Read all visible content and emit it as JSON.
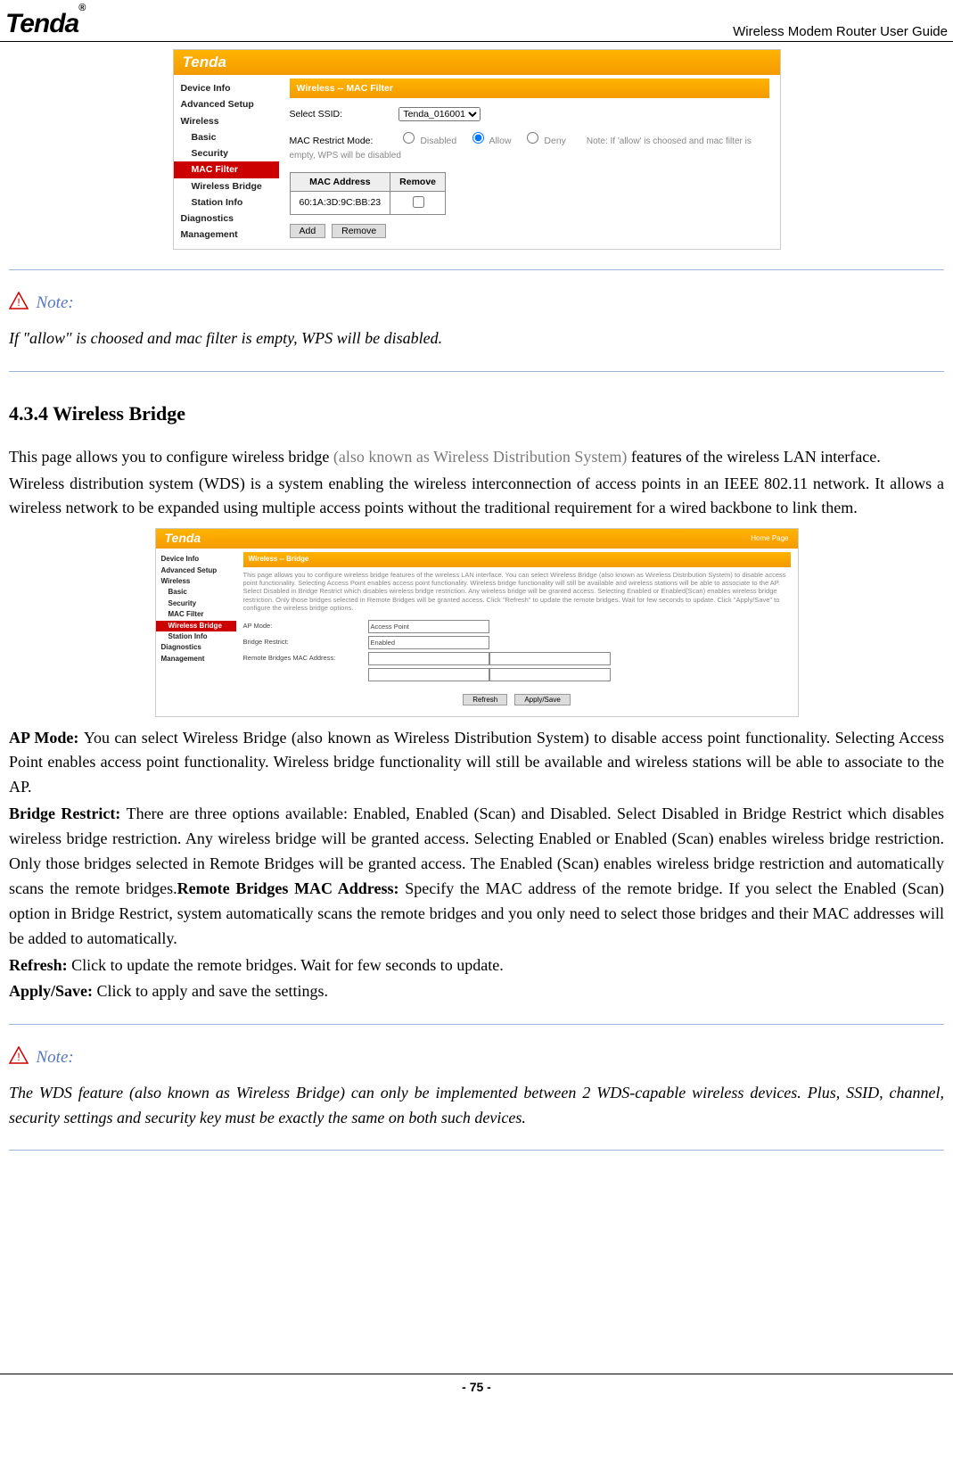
{
  "header": {
    "logo_text": "Tenda",
    "doc_title": "Wireless Modem Router User Guide"
  },
  "screenshot1": {
    "brand": "Tenda",
    "panel_title": "Wireless -- MAC Filter",
    "sidebar": {
      "items": [
        "Device Info",
        "Advanced Setup",
        "Wireless"
      ],
      "subs": [
        "Basic",
        "Security"
      ],
      "active": "MAC Filter",
      "subs2": [
        "Wireless Bridge",
        "Station Info"
      ],
      "items2": [
        "Diagnostics",
        "Management"
      ]
    },
    "ssid_label": "Select SSID:",
    "ssid_value": "Tenda_016001",
    "restrict_label": "MAC Restrict Mode:",
    "opt_disabled": "Disabled",
    "opt_allow": "Allow",
    "opt_deny": "Deny",
    "restrict_note": "Note: If 'allow' is choosed and mac filter is empty, WPS will be disabled",
    "col_mac": "MAC Address",
    "col_remove": "Remove",
    "mac_value": "60:1A:3D:9C:BB:23",
    "btn_add": "Add",
    "btn_remove": "Remove"
  },
  "note1": {
    "label": "Note:",
    "body": "If \"allow\" is choosed and mac filter is empty, WPS will be disabled."
  },
  "section": {
    "heading": "4.3.4 Wireless Bridge",
    "p1a": "This page allows you to configure wireless bridge ",
    "p1b": "(also known as Wireless Distribution System)",
    "p1c": " features of the wireless LAN interface.",
    "p2": "Wireless distribution system (WDS) is a system enabling the wireless interconnection of access points in an IEEE 802.11 network. It allows a wireless network to be expanded using multiple access points without the traditional requirement for a wired backbone to link them."
  },
  "screenshot2": {
    "brand": "Tenda",
    "home": "Home Page",
    "panel_title": "Wireless -- Bridge",
    "sidebar": {
      "items": [
        "Device Info",
        "Advanced Setup",
        "Wireless"
      ],
      "subs": [
        "Basic",
        "Security",
        "MAC Filter"
      ],
      "active": "Wireless Bridge",
      "subs2": [
        "Station Info"
      ],
      "items2": [
        "Diagnostics",
        "Management"
      ]
    },
    "desc": "This page allows you to configure wireless bridge features of the wireless LAN interface. You can select Wireless Bridge (also known as Wireless Distribution System) to disable access point functionality. Selecting Access Point enables access point functionality. Wireless bridge functionality will still be available and wireless stations will be able to associate to the AP. Select Disabled in Bridge Restrict which disables wireless bridge restriction. Any wireless bridge will be granted access. Selecting Enabled or Enabled(Scan) enables wireless bridge restriction. Only those bridges selected in Remote Bridges will be granted access. Click \"Refresh\" to update the remote bridges. Wait for few seconds to update. Click \"Apply/Save\" to configure the wireless bridge options.",
    "f_apmode_lbl": "AP Mode:",
    "f_apmode_val": "Access Point",
    "f_restrict_lbl": "Bridge Restrict:",
    "f_restrict_val": "Enabled",
    "f_remote_lbl": "Remote Bridges MAC Address:",
    "btn_refresh": "Refresh",
    "btn_apply": "Apply/Save"
  },
  "defs": {
    "apmode_label": "AP Mode: ",
    "apmode_body": "You can select Wireless Bridge (also known as Wireless Distribution System) to disable access point functionality. Selecting Access Point enables access point functionality. Wireless bridge functionality will still be available and wireless stations will be able to associate to the AP.",
    "brestrict_label": "Bridge Restrict: ",
    "brestrict_body": "There are three options available: Enabled, Enabled (Scan) and Disabled. Select Disabled in Bridge Restrict which disables wireless bridge restriction. Any wireless bridge will be granted access. Selecting Enabled or Enabled (Scan) enables wireless bridge restriction. Only those bridges selected in Remote Bridges will be granted access. The Enabled (Scan) enables wireless bridge restriction and automatically scans the remote bridges.",
    "remote_label": "Remote Bridges MAC Address: ",
    "remote_body": "Specify the MAC address of the remote bridge. If you select the Enabled (Scan) option in Bridge Restrict, system automatically scans the remote bridges and you only need to select those bridges and their MAC addresses will be added to automatically.",
    "refresh_label": "Refresh: ",
    "refresh_body": "Click to update the remote bridges. Wait for few seconds to update.",
    "apply_label": "Apply/Save: ",
    "apply_body": "Click to apply and save the settings."
  },
  "note2": {
    "label": "Note:",
    "body": "The WDS feature (also known as Wireless Bridge) can only be implemented between 2 WDS-capable wireless devices. Plus, SSID, channel, security settings and security key must be exactly the same on both such devices."
  },
  "footer": {
    "page_number": "- 75 -"
  }
}
